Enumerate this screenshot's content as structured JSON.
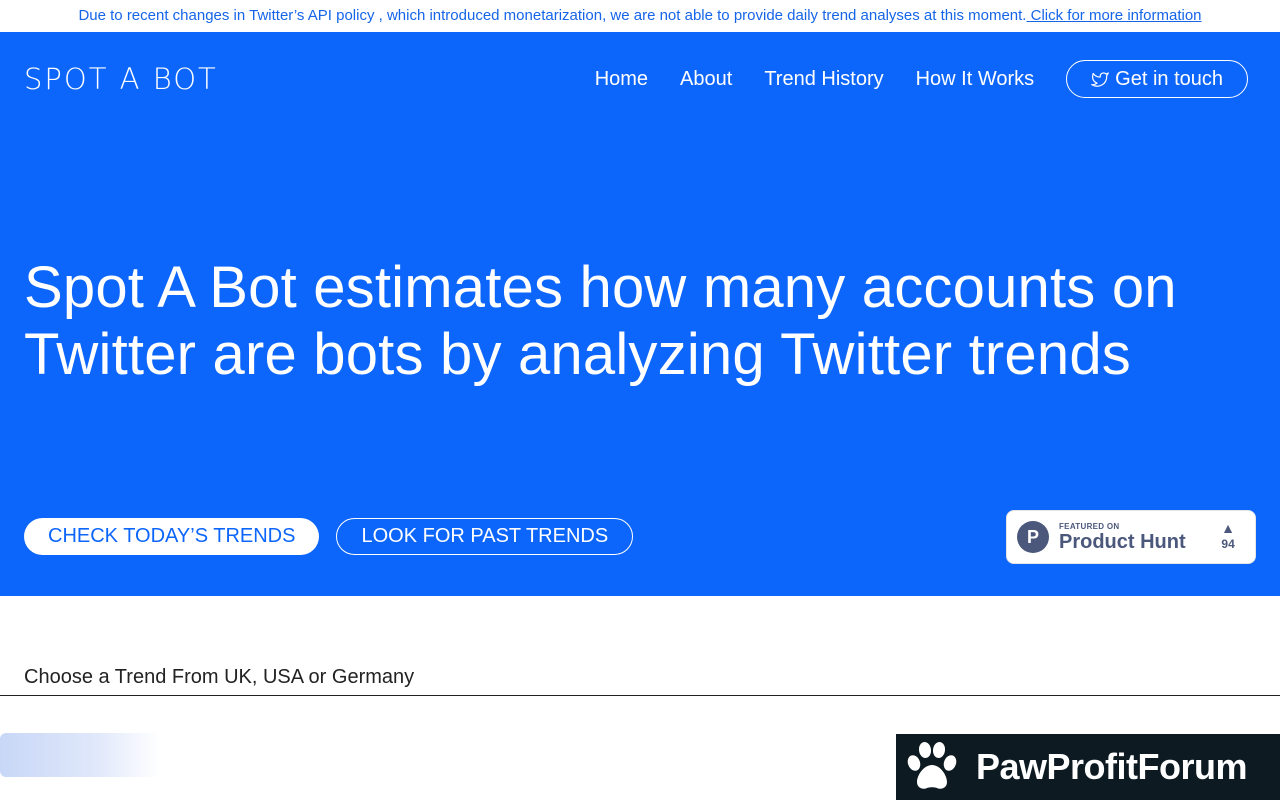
{
  "banner": {
    "text": "Due to recent changes in Twitter’s API policy , which introduced monetarization, we are not able to provide daily trend analyses at this moment.",
    "link": " Click for more information"
  },
  "header": {
    "logo": "SPOT A BOT",
    "nav": [
      "Home",
      "About",
      "Trend History",
      "How It Works"
    ],
    "contact_label": "Get in touch"
  },
  "hero": {
    "headline": "Spot A Bot estimates how many accounts on Twitter are bots by analyzing Twitter trends",
    "primary_button": "CHECK TODAY’S TRENDS",
    "secondary_button": "LOOK FOR PAST TRENDS"
  },
  "product_hunt": {
    "featured": "FEATURED ON",
    "name": "Product Hunt",
    "logo_letter": "P",
    "votes": "94"
  },
  "section": {
    "title": "Choose a Trend From UK, USA or Germany"
  },
  "watermark": {
    "text": "PawProfitForum"
  },
  "colors": {
    "brand_blue": "#0d66fb",
    "product_hunt": "#4b587c",
    "watermark_bg": "#0d1a22"
  }
}
